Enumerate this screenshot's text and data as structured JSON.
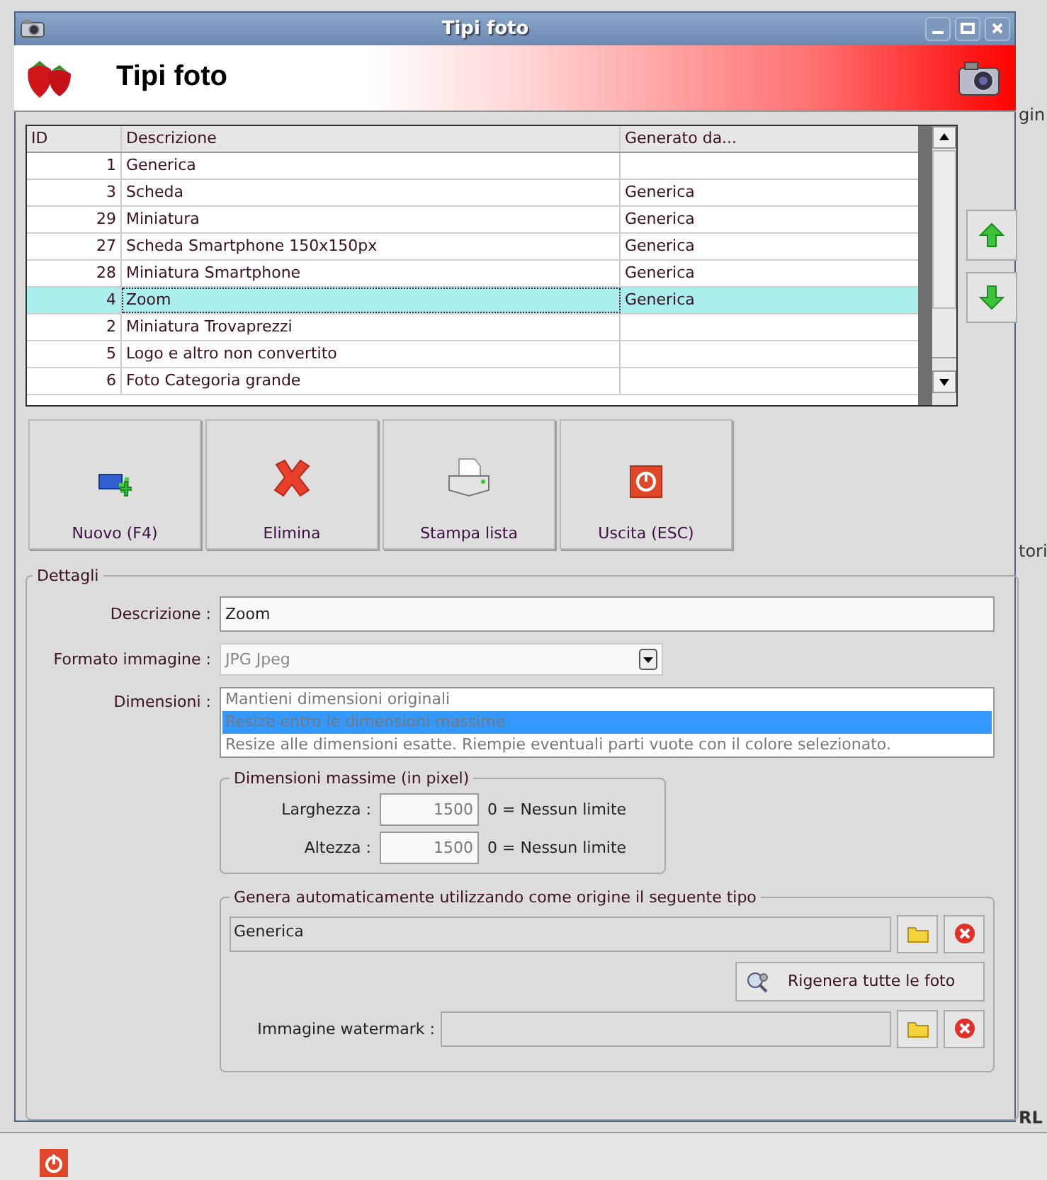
{
  "window": {
    "title": "Tipi foto"
  },
  "header": {
    "title": "Tipi foto"
  },
  "table": {
    "columns": [
      "ID",
      "Descrizione",
      "Generato da..."
    ],
    "rows": [
      {
        "id": "1",
        "descrizione": "Generica",
        "selected": false
      },
      {
        "id": "3",
        "descrizione": "Scheda",
        "generato_da": "Generica",
        "selected": false
      },
      {
        "id": "29",
        "descrizione": "Miniatura",
        "generato_da": "Generica",
        "selected": false
      },
      {
        "id": "27",
        "descrizione": "Scheda Smartphone 150x150px",
        "generato_da": "Generica",
        "selected": false
      },
      {
        "id": "28",
        "descrizione": "Miniatura Smartphone",
        "generato_da": "Generica",
        "selected": false
      },
      {
        "id": "4",
        "descrizione": "Zoom",
        "generato_da": "Generica",
        "selected": true
      },
      {
        "id": "2",
        "descrizione": "Miniatura Trovaprezzi",
        "selected": false
      },
      {
        "id": "5",
        "descrizione": "Logo e altro non convertito",
        "selected": false
      },
      {
        "id": "6",
        "descrizione": "Foto Categoria grande",
        "selected": false
      }
    ]
  },
  "toolbar": [
    {
      "label": "Nuovo (F4)",
      "kind": "new"
    },
    {
      "label": "Elimina",
      "kind": "delete"
    },
    {
      "label": "Stampa lista",
      "kind": "print"
    },
    {
      "label": "Uscita (ESC)",
      "kind": "exit"
    }
  ],
  "details": {
    "legend": "Dettagli",
    "descrizione": {
      "label": "Descrizione :",
      "value": "Zoom"
    },
    "formato": {
      "label": "Formato immagine :",
      "value": "JPG Jpeg",
      "disabled": true
    },
    "dimensioni": {
      "label": "Dimensioni :",
      "options": [
        {
          "label": "Mantieni dimensioni originali",
          "selected": false
        },
        {
          "label": "Resize entro le dimensioni massime",
          "selected": true
        },
        {
          "label": "Resize alle dimensioni esatte. Riempie eventuali parti vuote con il colore selezionato.",
          "selected": false
        }
      ]
    },
    "max_dimensions": {
      "legend": "Dimensioni massime (in pixel)",
      "fields": [
        {
          "label": "Larghezza :",
          "value": "1500",
          "hint": "0 = Nessun limite"
        },
        {
          "label": "Altezza :",
          "value": "1500",
          "hint": "0 = Nessun limite"
        }
      ]
    },
    "auto_generate": {
      "legend": "Genera automaticamente utilizzando come origine il seguente tipo",
      "source": "Generica",
      "regenerate_button": "Rigenera tutte le foto",
      "watermark_label": "Immagine watermark :"
    }
  },
  "background_fragments": [
    "gin",
    "tori",
    "RL"
  ]
}
